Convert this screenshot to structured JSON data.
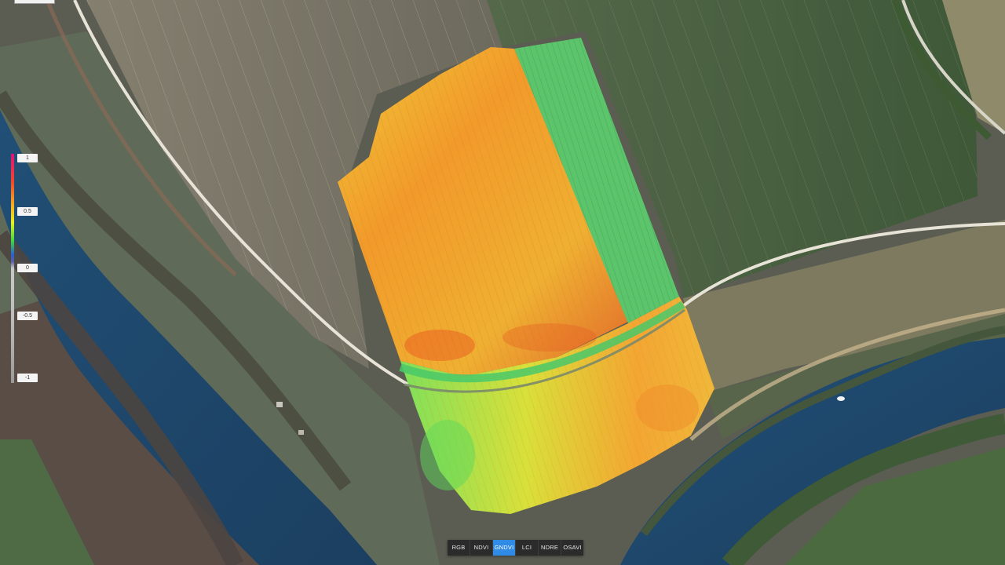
{
  "legend": {
    "label_1": "1",
    "label_05": "0.5",
    "label_0": "0",
    "label_m05": "-0.5",
    "label_m1": "-1"
  },
  "toolbar": {
    "buttons": [
      "RGB",
      "NDVI",
      "GNDVI",
      "LCI",
      "NDRE",
      "OSAVI"
    ],
    "active_index": 2
  },
  "colors": {
    "index_high": "#e0127a",
    "index_orange": "#f2462a",
    "index_yellow": "#e6f01e",
    "index_green": "#3fd83f",
    "river": "#1f4f75",
    "active_button": "#2f8be6"
  }
}
